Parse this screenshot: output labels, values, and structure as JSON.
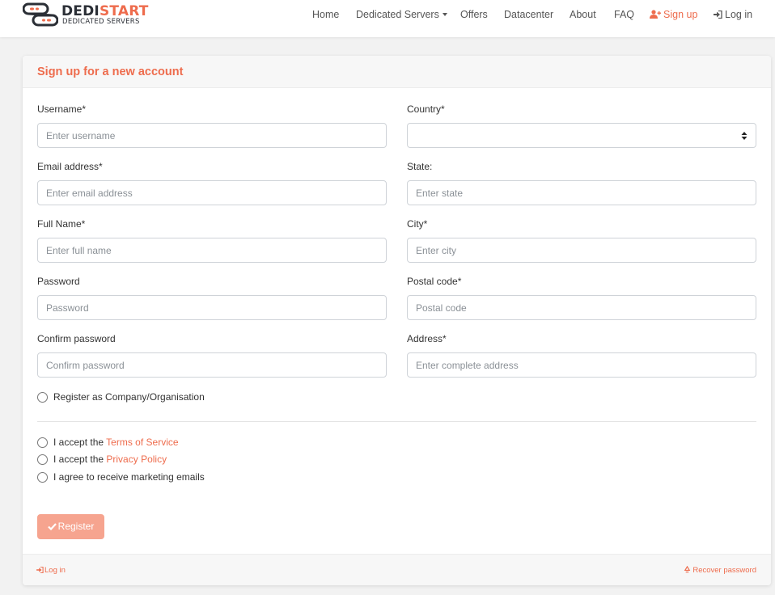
{
  "brand": {
    "name_part1": "DEDI",
    "name_part2": "START",
    "tagline": "DEDICATED SERVERS",
    "colors": {
      "accent": "#ee6c4d",
      "dark": "#2b2f36"
    }
  },
  "nav": {
    "home": "Home",
    "dedicated_servers": "Dedicated Servers",
    "offers": "Offers",
    "datacenter": "Datacenter",
    "about": "About",
    "faq": "FAQ",
    "signup": "Sign up",
    "login": "Log in",
    "signup_icon": "user-plus-icon",
    "login_icon": "sign-in-icon"
  },
  "form": {
    "title": "Sign up for a new account",
    "username": {
      "label": "Username*",
      "placeholder": "Enter username"
    },
    "email": {
      "label": "Email address*",
      "placeholder": "Enter email address"
    },
    "full_name": {
      "label": "Full Name*",
      "placeholder": "Enter full name"
    },
    "password": {
      "label": "Password",
      "placeholder": "Password"
    },
    "confirm_password": {
      "label": "Confirm password",
      "placeholder": "Confirm password"
    },
    "country": {
      "label": "Country*",
      "value": ""
    },
    "state": {
      "label": "State:",
      "placeholder": "Enter state"
    },
    "city": {
      "label": "City*",
      "placeholder": "Enter city"
    },
    "postal_code": {
      "label": "Postal code*",
      "placeholder": "Postal code"
    },
    "address": {
      "label": "Address*",
      "placeholder": "Enter complete address"
    },
    "company_checkbox": "Register as Company/Organisation",
    "terms_prefix": "I accept the",
    "terms_link": "Terms of Service",
    "privacy_prefix": "I accept the",
    "privacy_link": "Privacy Policy",
    "marketing": "I agree to receive marketing emails",
    "register_button": "Register",
    "register_icon": "check-icon"
  },
  "footer": {
    "login": "Log in",
    "recover": "Recover password",
    "login_icon": "sign-in-icon",
    "recover_icon": "recycle-icon"
  }
}
